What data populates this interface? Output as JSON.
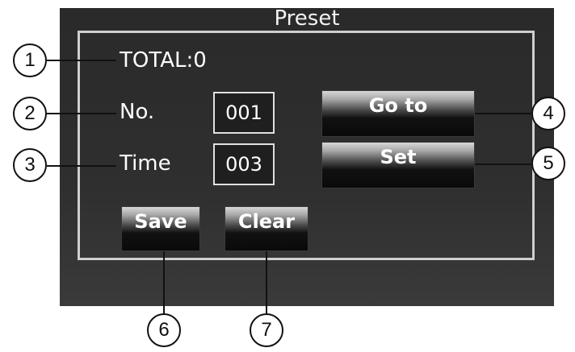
{
  "dialog": {
    "title": "Preset",
    "total_label": "TOTAL:0",
    "no_label": "No.",
    "no_value": "001",
    "time_label": "Time",
    "time_value": "003"
  },
  "buttons": {
    "goto": "Go to",
    "set": "Set",
    "save": "Save",
    "clear": "Clear"
  },
  "callouts": [
    "1",
    "2",
    "3",
    "4",
    "5",
    "6",
    "7"
  ]
}
